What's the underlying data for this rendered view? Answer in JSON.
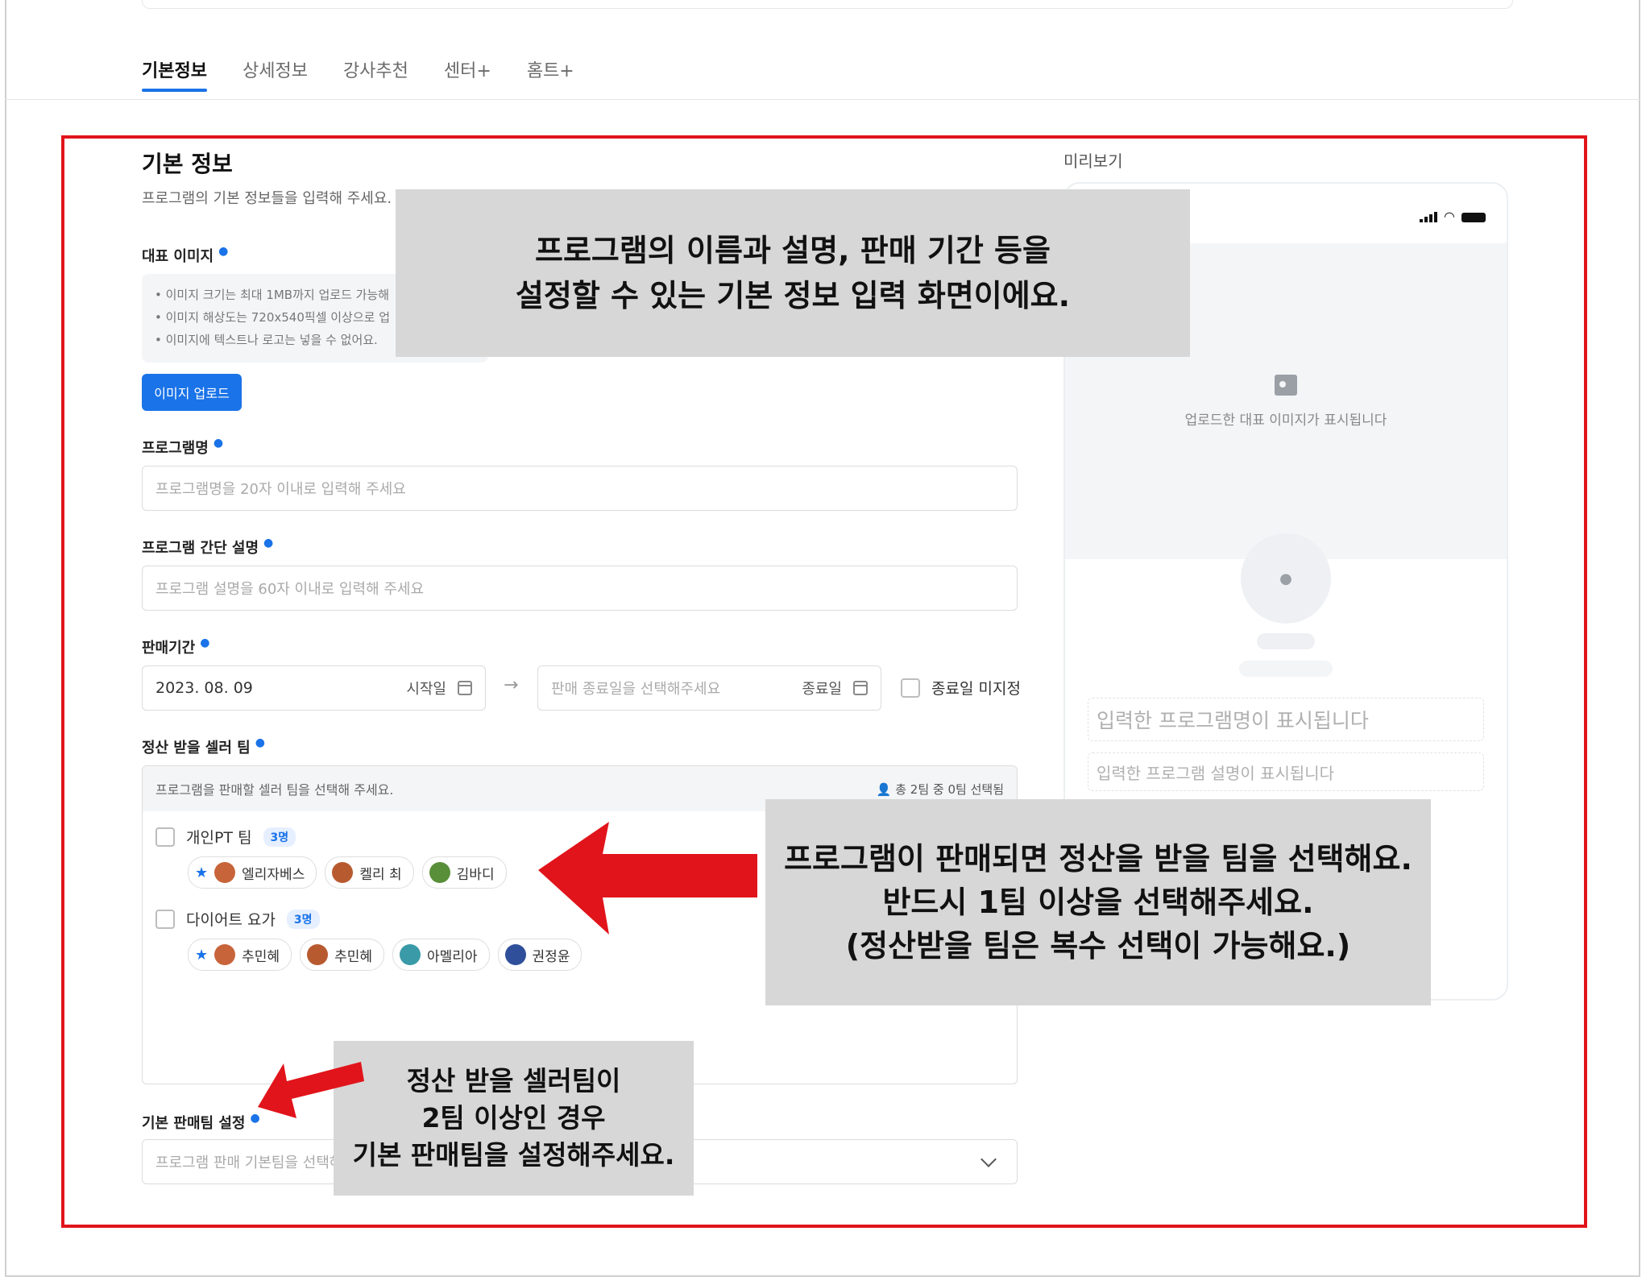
{
  "tabs": [
    {
      "label": "기본정보",
      "active": true
    },
    {
      "label": "상세정보",
      "active": false
    },
    {
      "label": "강사추천",
      "active": false
    },
    {
      "label": "센터+",
      "active": false
    },
    {
      "label": "홈트+",
      "active": false
    }
  ],
  "section": {
    "title": "기본 정보",
    "description": "프로그램의 기본 정보들을 입력해 주세요."
  },
  "image": {
    "label": "대표 이미지",
    "notes": [
      "• 이미지 크기는 최대 1MB까지 업로드 가능해",
      "• 이미지 해상도는 720x540픽셀 이상으로 업",
      "• 이미지에 텍스트나 로고는 넣을 수 없어요."
    ],
    "upload_button": "이미지 업로드"
  },
  "program_name": {
    "label": "프로그램명",
    "placeholder": "프로그램명을 20자 이내로 입력해 주세요"
  },
  "program_desc": {
    "label": "프로그램 간단 설명",
    "placeholder": "프로그램 설명을 60자 이내로 입력해 주세요"
  },
  "sale_period": {
    "label": "판매기간",
    "start_value": "2023. 08. 09",
    "start_suffix": "시작일",
    "arrow": "→",
    "end_placeholder": "판매 종료일을 선택해주세요",
    "end_suffix": "종료일",
    "no_end_label": "종료일 미지정"
  },
  "seller_team": {
    "label": "정산 받을 셀러 팀",
    "hint": "프로그램을 판매할 셀러 팀을 선택해 주세요.",
    "count": "총 2팀 중 0팀 선택됨",
    "teams": [
      {
        "name": "개인PT 팀",
        "badge": "3명",
        "members": [
          "엘리자베스",
          "켈리 최",
          "김바디"
        ]
      },
      {
        "name": "다이어트 요가",
        "badge": "3명",
        "members": [
          "추민혜",
          "추민혜",
          "아멜리아",
          "권정윤"
        ]
      }
    ]
  },
  "default_team": {
    "label": "기본 판매팀 설정",
    "placeholder": "프로그램 판매 기본팀을 선택해"
  },
  "preview": {
    "title": "미리보기",
    "image_text": "업로드한 대표 이미지가 표시됩니다",
    "name_text": "입력한 프로그램명이 표시됩니다",
    "desc_text": "입력한 프로그램 설명이 표시됩니다"
  },
  "callouts": {
    "top": [
      "프로그램의 이름과 설명, 판매 기간 등을",
      "설정할 수 있는 기본 정보 입력 화면이에요."
    ],
    "right": [
      "프로그램이 판매되면 정산을 받을 팀을 선택해요.",
      "반드시 1팀 이상을 선택해주세요.",
      "(정산받을 팀은 복수 선택이 가능해요.)"
    ],
    "bottom": [
      "정산 받을 셀러팀이",
      "2팀 이상인 경우",
      "기본 판매팀을 설정해주세요."
    ]
  },
  "colors": {
    "accent": "#1a73e8",
    "annotation_red": "#e1141b",
    "callout_bg": "#d7d7d7"
  }
}
